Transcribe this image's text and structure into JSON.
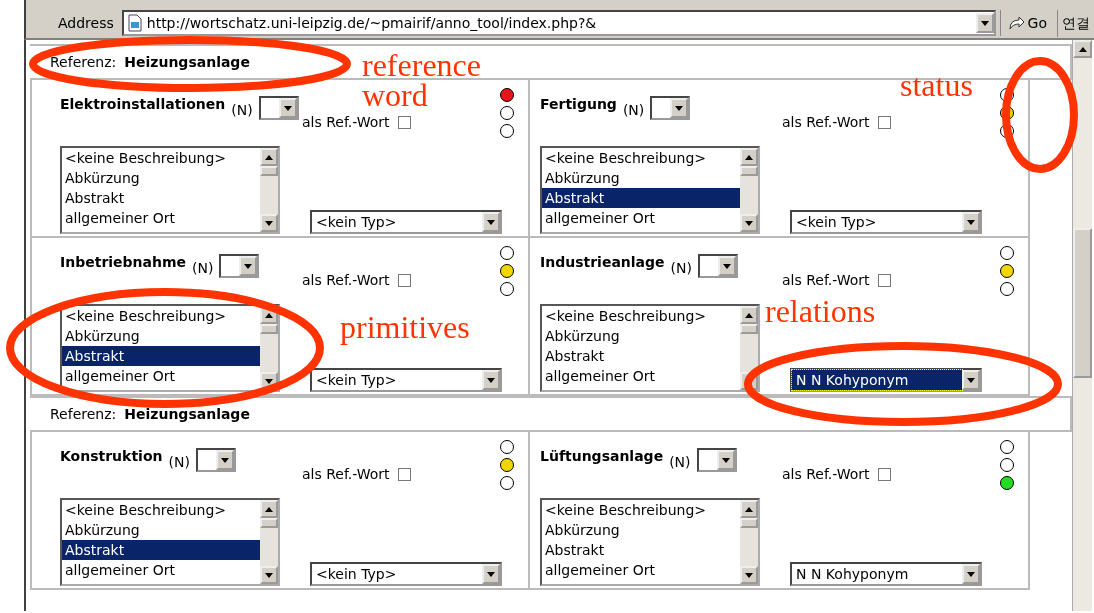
{
  "address_bar": {
    "label": "Address",
    "url": "http://wortschatz.uni-leipzig.de/~pmairif/anno_tool/index.php?&",
    "go": "Go",
    "links": "연결"
  },
  "sections": [
    {
      "reference_label": "Referenz:",
      "reference_word": "Heizungsanlage",
      "panels": [
        {
          "word": "Elektroinstallationen",
          "pos": "(N)",
          "ref_label": "als Ref.-Wort",
          "ref_checked": false,
          "descriptions": [
            {
              "text": "<keine Beschreibung>",
              "selected": false
            },
            {
              "text": "Abkürzung",
              "selected": false
            },
            {
              "text": "Abstrakt",
              "selected": false
            },
            {
              "text": "allgemeiner Ort",
              "selected": false
            }
          ],
          "type": {
            "value": "<kein Typ>",
            "highlighted": false
          },
          "lights": [
            {
              "on": true,
              "color": "#e8141a"
            },
            {
              "on": false
            },
            {
              "on": false
            }
          ]
        },
        {
          "word": "Fertigung",
          "pos": "(N)",
          "ref_label": "als Ref.-Wort",
          "ref_checked": false,
          "descriptions": [
            {
              "text": "<keine Beschreibung>",
              "selected": false
            },
            {
              "text": "Abkürzung",
              "selected": false
            },
            {
              "text": "Abstrakt",
              "selected": true
            },
            {
              "text": "allgemeiner Ort",
              "selected": false
            }
          ],
          "type": {
            "value": "<kein Typ>",
            "highlighted": false
          },
          "lights": [
            {
              "on": false
            },
            {
              "on": true,
              "color": "#f2d600"
            },
            {
              "on": false
            }
          ]
        },
        {
          "word": "Inbetriebnahme",
          "pos": "(N)",
          "ref_label": "als Ref.-Wort",
          "ref_checked": false,
          "descriptions": [
            {
              "text": "<keine Beschreibung>",
              "selected": false
            },
            {
              "text": "Abkürzung",
              "selected": false
            },
            {
              "text": "Abstrakt",
              "selected": true
            },
            {
              "text": "allgemeiner Ort",
              "selected": false
            }
          ],
          "type": {
            "value": "<kein Typ>",
            "highlighted": false
          },
          "lights": [
            {
              "on": false
            },
            {
              "on": true,
              "color": "#f2d600"
            },
            {
              "on": false
            }
          ]
        },
        {
          "word": "Industrieanlage",
          "pos": "(N)",
          "ref_label": "als Ref.-Wort",
          "ref_checked": false,
          "descriptions": [
            {
              "text": "<keine Beschreibung>",
              "selected": false
            },
            {
              "text": "Abkürzung",
              "selected": false
            },
            {
              "text": "Abstrakt",
              "selected": false
            },
            {
              "text": "allgemeiner Ort",
              "selected": false
            }
          ],
          "type": {
            "value": "N N Kohyponym",
            "highlighted": true
          },
          "lights": [
            {
              "on": false
            },
            {
              "on": true,
              "color": "#f2d600"
            },
            {
              "on": false
            }
          ]
        }
      ]
    },
    {
      "reference_label": "Referenz:",
      "reference_word": "Heizungsanlage",
      "panels": [
        {
          "word": "Konstruktion",
          "pos": "(N)",
          "ref_label": "als Ref.-Wort",
          "ref_checked": false,
          "descriptions": [
            {
              "text": "<keine Beschreibung>",
              "selected": false
            },
            {
              "text": "Abkürzung",
              "selected": false
            },
            {
              "text": "Abstrakt",
              "selected": true
            },
            {
              "text": "allgemeiner Ort",
              "selected": false
            }
          ],
          "type": {
            "value": "<kein Typ>",
            "highlighted": false
          },
          "lights": [
            {
              "on": false
            },
            {
              "on": true,
              "color": "#f2d600"
            },
            {
              "on": false
            }
          ]
        },
        {
          "word": "Lüftungsanlage",
          "pos": "(N)",
          "ref_label": "als Ref.-Wort",
          "ref_checked": false,
          "descriptions": [
            {
              "text": "<keine Beschreibung>",
              "selected": false
            },
            {
              "text": "Abkürzung",
              "selected": false
            },
            {
              "text": "Abstrakt",
              "selected": false
            },
            {
              "text": "allgemeiner Ort",
              "selected": false
            }
          ],
          "type": {
            "value": "N N Kohyponym",
            "highlighted": false
          },
          "lights": [
            {
              "on": false
            },
            {
              "on": false
            },
            {
              "on": true,
              "color": "#22dd22"
            }
          ]
        }
      ]
    }
  ],
  "annotations": [
    {
      "text": "reference word"
    },
    {
      "text": "status"
    },
    {
      "text": "primitives"
    },
    {
      "text": "relations"
    }
  ]
}
